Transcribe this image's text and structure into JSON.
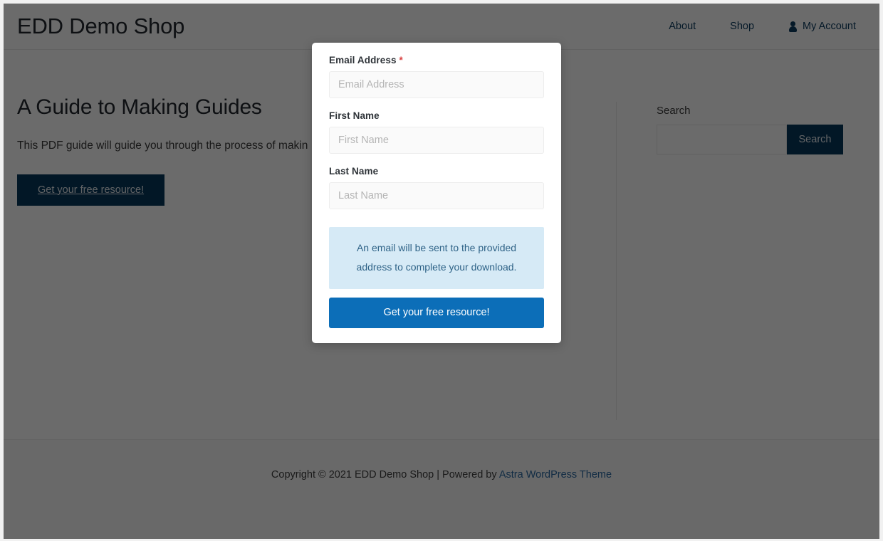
{
  "header": {
    "site_title": "EDD Demo Shop",
    "nav": [
      {
        "label": "About",
        "icon": null
      },
      {
        "label": "Shop",
        "icon": null
      },
      {
        "label": "My Account",
        "icon": "person-icon"
      }
    ]
  },
  "main": {
    "entry_title": "A Guide to Making Guides",
    "entry_text": "This PDF guide will guide you through the process of makin",
    "cta_label": "Get your free resource!"
  },
  "sidebar": {
    "search_widget_title": "Search",
    "search_value": "",
    "search_placeholder": "",
    "search_button_label": "Search"
  },
  "modal": {
    "email": {
      "label": "Email Address",
      "required_marker": "*",
      "value": "",
      "placeholder": "Email Address"
    },
    "first_name": {
      "label": "First Name",
      "value": "",
      "placeholder": "First Name"
    },
    "last_name": {
      "label": "Last Name",
      "value": "",
      "placeholder": "Last Name"
    },
    "notice": "An email will be sent to the provided address to complete your download.",
    "submit_label": "Get your free resource!"
  },
  "footer": {
    "copyright_text": "Copyright © 2021 EDD Demo Shop | Powered by ",
    "theme_link": "Astra WordPress Theme"
  },
  "colors": {
    "accent_dark": "#06375b",
    "accent_blue": "#0c6eb8",
    "notice_bg": "#d6eaf6",
    "notice_text": "#2f6387",
    "link": "#2b6aa3",
    "required": "#d94141",
    "overlay": "rgba(0,0,0,0.58)"
  }
}
